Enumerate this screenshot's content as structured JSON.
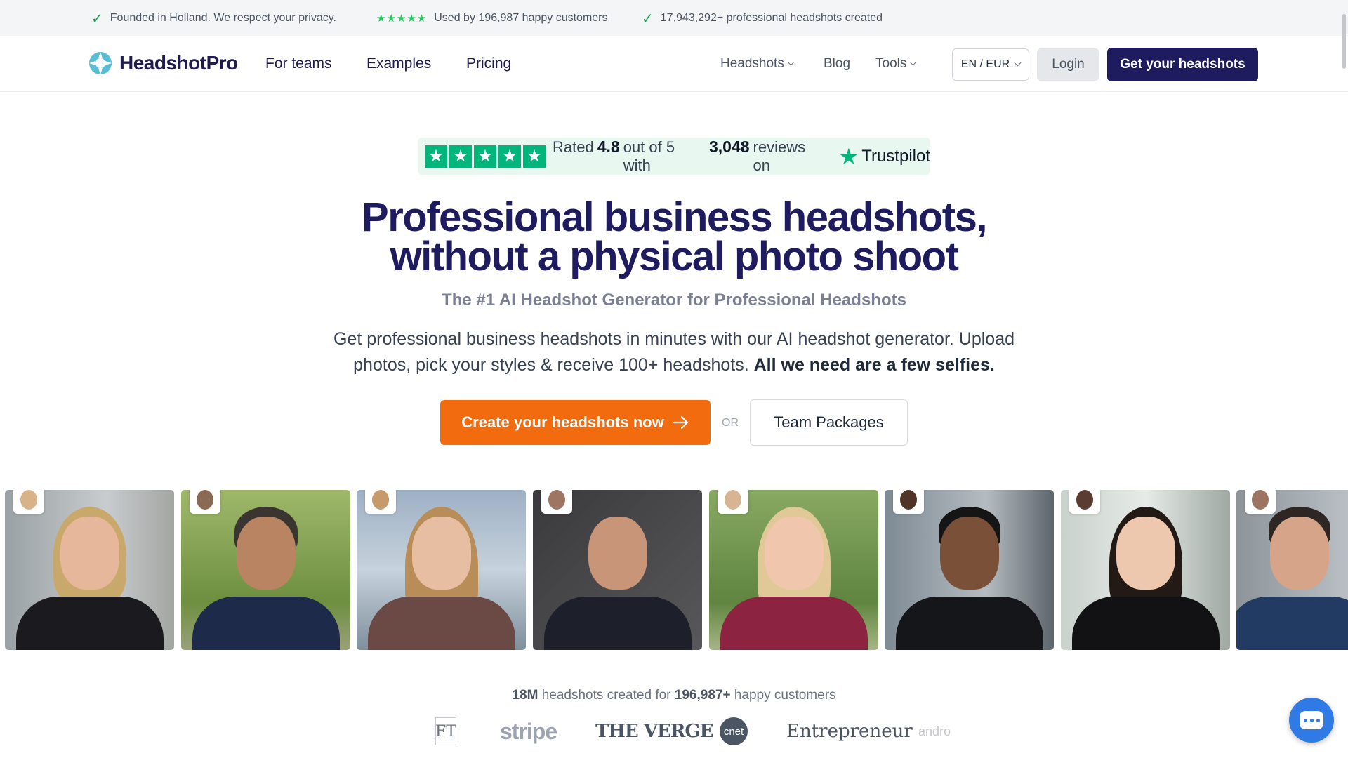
{
  "trustbar": {
    "item1": "Founded in Holland. We respect your privacy.",
    "item2": "Used by 196,987 happy customers",
    "item3": "17,943,292+ professional headshots created",
    "stars": "★★★★★"
  },
  "nav": {
    "logo": "HeadshotPro",
    "links": [
      "For teams",
      "Examples",
      "Pricing"
    ],
    "right_links": [
      "Headshots",
      "Blog",
      "Tools"
    ],
    "lang": "EN / EUR",
    "login": "Login",
    "cta": "Get your headshots"
  },
  "trustpilot": {
    "rated": "Rated",
    "rating": "4.8",
    "out_of": "out of 5 with",
    "reviews": "3,048",
    "reviews_on": "reviews on",
    "brand": "Trustpilot"
  },
  "hero": {
    "title_line1": "Professional business headshots,",
    "title_line2": "without a physical photo shoot",
    "subtitle": "The #1 AI Headshot Generator for Professional Headshots",
    "desc": "Get professional business headshots in minutes with our AI headshot generator. Upload photos, pick your styles & receive 100+ headshots.",
    "desc_bold": "All we need are a few selfies.",
    "cta_main": "Create your headshots now",
    "or": "OR",
    "cta_team": "Team Packages"
  },
  "stats": {
    "count1": "18M",
    "text1": "headshots created for",
    "count2": "196,987+",
    "text2": "happy customers"
  },
  "press": [
    "FT",
    "stripe",
    "THE VERGE",
    "cnet",
    "Entrepreneur",
    "andro"
  ],
  "colors": {
    "navy": "#1e1b5e",
    "orange": "#f26b0f",
    "green": "#00b67a",
    "chat": "#2f7ae5"
  }
}
